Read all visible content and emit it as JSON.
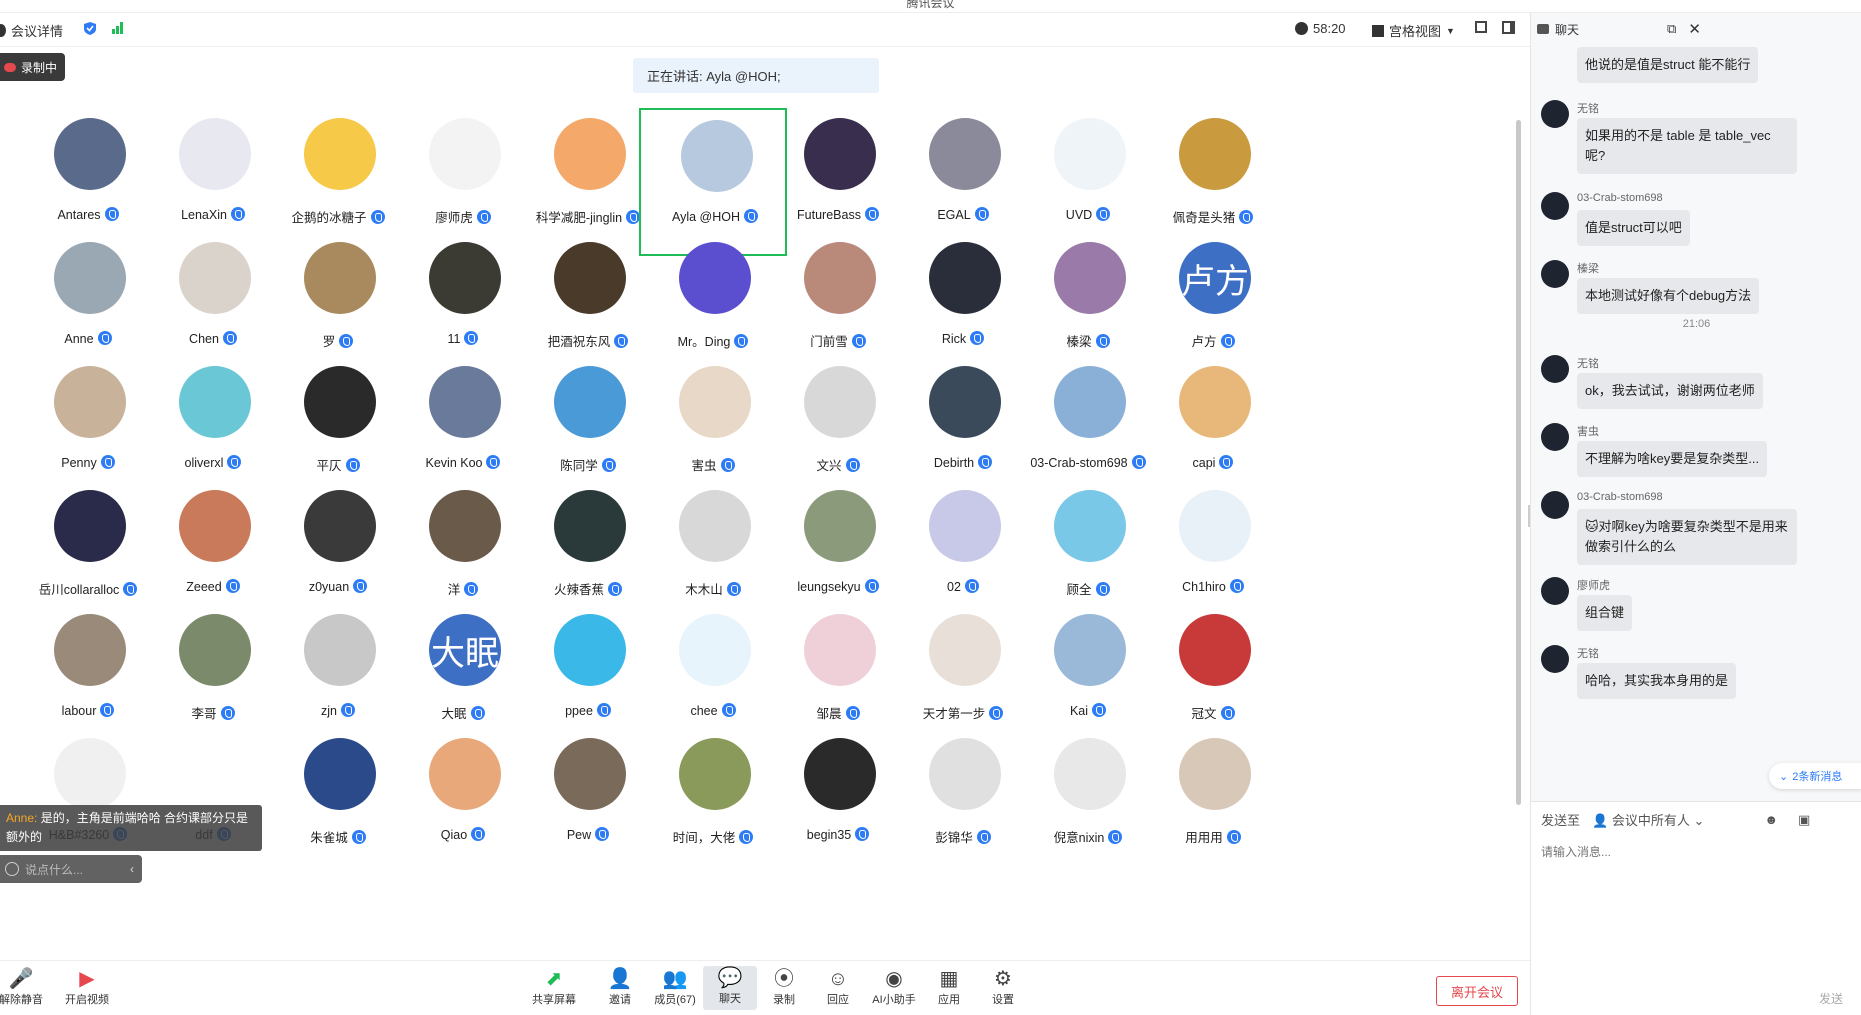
{
  "window": {
    "title": "腾讯会议"
  },
  "toolbar": {
    "meeting_details": "会议详情",
    "timer": "58:20",
    "view_mode": "宫格视图"
  },
  "recording": {
    "label": "录制中"
  },
  "speaker_banner": "正在讲话: Ayla @HOH;",
  "participants": [
    {
      "name": "Antares",
      "color": "#5a6a8a"
    },
    {
      "name": "LenaXin",
      "color": "#e8e8f0"
    },
    {
      "name": "企鹅的冰糖子",
      "color": "#f7c948"
    },
    {
      "name": "廖师虎",
      "color": "#f3f3f3"
    },
    {
      "name": "科学减肥-jinglin",
      "color": "#f4a96a"
    },
    {
      "name": "Ayla @HOH",
      "color": "#b7c9de"
    },
    {
      "name": "FutureBass",
      "color": "#3a2e4f"
    },
    {
      "name": "EGAL",
      "color": "#8a8a9a"
    },
    {
      "name": "UVD",
      "color": "#eef4f8"
    },
    {
      "name": "佩奇是头猪",
      "color": "#c99a3e"
    },
    {
      "name": "Anne",
      "color": "#9aa8b4"
    },
    {
      "name": "Chen",
      "color": "#d9d3cc"
    },
    {
      "name": "罗",
      "color": "#a88a5e"
    },
    {
      "name": "11",
      "color": "#3b3a33"
    },
    {
      "name": "把酒祝东风",
      "color": "#4a3a2a"
    },
    {
      "name": "Mr。Ding",
      "color": "#5b4fd0"
    },
    {
      "name": "门前雪",
      "color": "#b98a7a"
    },
    {
      "name": "Rick",
      "color": "#2a2e3a"
    },
    {
      "name": "榛梁",
      "color": "#9a7aa8"
    },
    {
      "name": "卢方",
      "color": "#3d6fc4",
      "text": "卢方"
    },
    {
      "name": "Penny",
      "color": "#c8b29a"
    },
    {
      "name": "oliverxl",
      "color": "#6ac8d6"
    },
    {
      "name": "平仄",
      "color": "#2a2a2a"
    },
    {
      "name": "Kevin Koo",
      "color": "#6a7a9a"
    },
    {
      "name": "陈同学",
      "color": "#4a9ad8"
    },
    {
      "name": "害虫",
      "color": "#e8d8c8"
    },
    {
      "name": "文兴",
      "color": "#d8d8d8"
    },
    {
      "name": "Debirth",
      "color": "#3a4a5a"
    },
    {
      "name": "03-Crab-stom698",
      "color": "#8ab0d8"
    },
    {
      "name": "capi",
      "color": "#e8b87a"
    },
    {
      "name": "岳川collaralloc",
      "color": "#2a2a4a"
    },
    {
      "name": "Zeeed",
      "color": "#c87a5a"
    },
    {
      "name": "z0yuan",
      "color": "#3a3a3a"
    },
    {
      "name": "洋",
      "color": "#6a5a4a"
    },
    {
      "name": "火辣香蕉",
      "color": "#2a3a3a"
    },
    {
      "name": "木木山",
      "color": "#d8d8d8"
    },
    {
      "name": "leungsekyu",
      "color": "#8a9a7a"
    },
    {
      "name": "02",
      "color": "#c8c8e8"
    },
    {
      "name": "顾全",
      "color": "#7ac8e8"
    },
    {
      "name": "Ch1hiro",
      "color": "#e8f0f8"
    },
    {
      "name": "labour",
      "color": "#9a8a7a"
    },
    {
      "name": "李哥",
      "color": "#7a8a6a"
    },
    {
      "name": "zjn",
      "color": "#c8c8c8"
    },
    {
      "name": "大眠",
      "color": "#3d6fc4",
      "text": "大眠"
    },
    {
      "name": "ppee",
      "color": "#3ab8e8"
    },
    {
      "name": "chee",
      "color": "#e8f4fc"
    },
    {
      "name": "邹晨",
      "color": "#f0d0d8"
    },
    {
      "name": "天才第一步",
      "color": "#e8e0d8"
    },
    {
      "name": "Kai",
      "color": "#9ab8d8"
    },
    {
      "name": "冠文",
      "color": "#c83a3a"
    },
    {
      "name": "H&B#3260",
      "color": "#f0f0f0"
    },
    {
      "name": "ddf",
      "color": "#ffffff"
    },
    {
      "name": "朱雀城",
      "color": "#2a4a8a"
    },
    {
      "name": "Qiao",
      "color": "#e8a87a"
    },
    {
      "name": "Pew",
      "color": "#7a6a5a"
    },
    {
      "name": "时间，大佬",
      "color": "#8a9a5a"
    },
    {
      "name": "begin35",
      "color": "#2a2a2a"
    },
    {
      "name": "彭锦华",
      "color": "#e0e0e0"
    },
    {
      "name": "倪意nixin",
      "color": "#e8e8e8"
    },
    {
      "name": "用用用",
      "color": "#d8c8b8"
    }
  ],
  "caption": {
    "speaker": "Anne:",
    "text": "是的，主角是前端哈哈 合约课部分只是额外的"
  },
  "comment": {
    "placeholder": "说点什么..."
  },
  "bottom": {
    "mute": "解除静音",
    "video": "开启视频",
    "share": "共享屏幕",
    "invite": "邀请",
    "members": "成员(67)",
    "chat": "聊天",
    "record": "录制",
    "reactions": "回应",
    "ai": "AI小助手",
    "apps": "应用",
    "settings": "设置",
    "leave": "离开会议"
  },
  "chat": {
    "title": "聊天",
    "messages": [
      {
        "sender": "",
        "text": "他说的是值是struct 能不能行"
      },
      {
        "sender": "无铭",
        "text": "如果用的不是 table 是 table_vec 呢?"
      },
      {
        "sender": "03-Crab-stom698",
        "text": "值是struct可以吧"
      },
      {
        "sender": "榛梁",
        "text": "本地测试好像有个debug方法"
      },
      {
        "sender": "无铭",
        "text": "ok，我去试试，谢谢两位老师"
      },
      {
        "sender": "害虫",
        "text": "不理解为啥key要是复杂类型..."
      },
      {
        "sender": "03-Crab-stom698",
        "text": "🐱对啊key为啥要复杂类型不是用来做索引什么的么"
      },
      {
        "sender": "廖师虎",
        "text": "组合键"
      },
      {
        "sender": "无铭",
        "text": "哈哈，其实我本身用的是"
      }
    ],
    "time_sep": "21:06",
    "new_messages": "2条新消息",
    "send_to_label": "发送至",
    "recipient": "会议中所有人",
    "input_placeholder": "请输入消息...",
    "send": "发送"
  }
}
